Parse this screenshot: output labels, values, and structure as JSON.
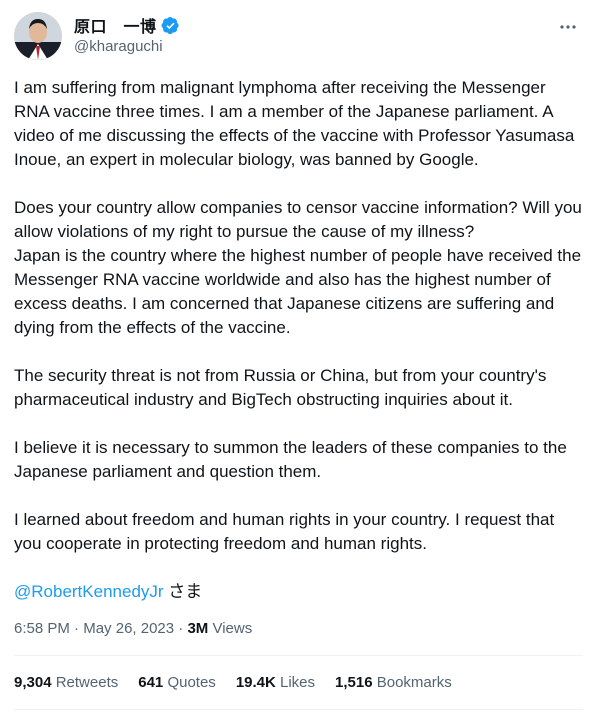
{
  "author": {
    "display_name": "原口　一博",
    "handle": "@kharaguchi",
    "verified_icon": "verified-badge-icon",
    "accent_color": "#1d9bf0"
  },
  "tweet": {
    "paragraphs": [
      "I am suffering from malignant lymphoma after receiving the Messenger RNA vaccine three times. I am a member of the Japanese parliament. A video of me discussing the effects of the vaccine with Professor Yasumasa Inoue, an expert in molecular biology, was banned by Google.",
      "Does your country allow companies to censor vaccine information? Will you allow violations of my right to pursue the cause of my illness?",
      "Japan is the country where the highest number of people have received the Messenger RNA vaccine worldwide and also has the highest number of excess deaths. I am concerned that Japanese citizens are suffering and dying from the effects of the vaccine.",
      "The security threat is not from Russia or China, but from your country's pharmaceutical industry and BigTech obstructing inquiries about it.",
      "I believe it is necessary to summon the leaders of these companies to the Japanese parliament and question them.",
      "I learned about freedom and human rights in your country. I request that you cooperate in protecting freedom and human rights."
    ],
    "mention": "@RobertKennedyJr",
    "mention_suffix": " さま",
    "time": "6:58 PM",
    "separator1": " · ",
    "date": "May 26, 2023",
    "separator2": " · ",
    "views_count": "3M",
    "views_label": " Views"
  },
  "stats": {
    "retweets": {
      "count": "9,304",
      "label": " Retweets"
    },
    "quotes": {
      "count": "641",
      "label": " Quotes"
    },
    "likes": {
      "count": "19.4K",
      "label": " Likes"
    },
    "bookmarks": {
      "count": "1,516",
      "label": " Bookmarks"
    }
  }
}
